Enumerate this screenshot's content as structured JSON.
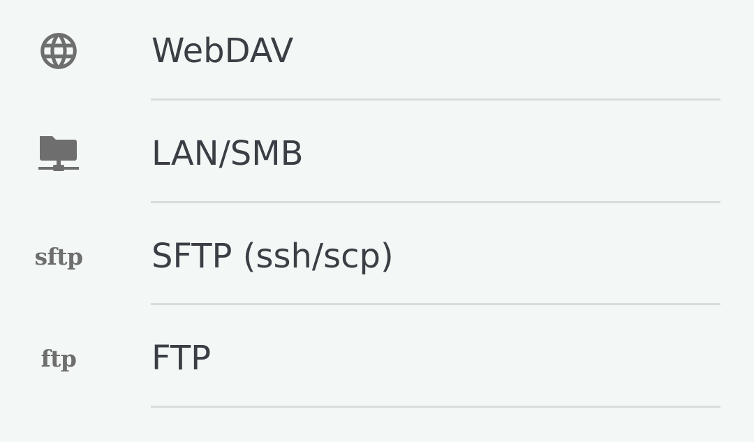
{
  "items": [
    {
      "label": "WebDAV",
      "icon": "globe-icon"
    },
    {
      "label": "LAN/SMB",
      "icon": "network-folder-icon"
    },
    {
      "label": "SFTP (ssh/scp)",
      "icon": "sftp-icon",
      "icon_text": "sftp"
    },
    {
      "label": "FTP",
      "icon": "ftp-icon",
      "icon_text": "ftp"
    }
  ],
  "colors": {
    "background": "#f3f8f6",
    "icon": "#6e6e6e",
    "text": "#3b3f45",
    "divider": "#d9dcdb"
  }
}
